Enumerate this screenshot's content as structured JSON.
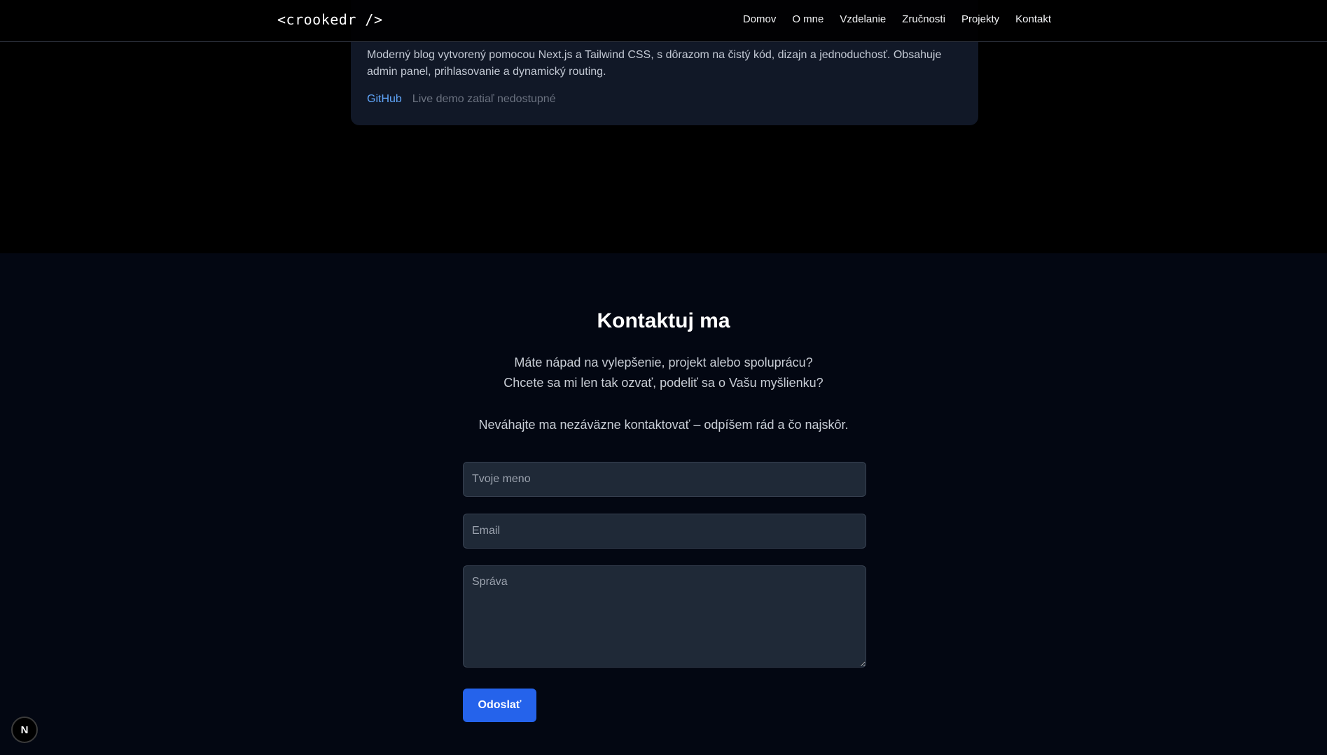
{
  "nav": {
    "logo": "<crookedr />",
    "links": [
      "Domov",
      "O mne",
      "Vzdelanie",
      "Zručnosti",
      "Projekty",
      "Kontakt"
    ]
  },
  "project": {
    "description": "Moderný blog vytvorený pomocou Next.js a Tailwind CSS, s dôrazom na čistý kód, dizajn a jednoduchosť. Obsahuje admin panel, prihlasovanie a dynamický routing.",
    "github_label": "GitHub",
    "demo_label": "Live demo zatiaľ nedostupné"
  },
  "contact": {
    "title": "Kontaktuj ma",
    "intro_line1": "Máte nápad na vylepšenie, projekt alebo spoluprácu?",
    "intro_line2": "Chcete sa mi len tak ozvať, podeliť sa o Vašu myšlienku?",
    "note": "Neváhajte ma nezáväzne kontaktovať – odpíšem rád a čo najskôr.",
    "name_placeholder": "Tvoje meno",
    "email_placeholder": "Email",
    "message_placeholder": "Správa",
    "submit_label": "Odoslať"
  },
  "dev_badge": {
    "icon": "nextjs-logo-icon",
    "letter": "N"
  },
  "colors": {
    "accent": "#2563eb",
    "link": "#60a5fa",
    "section_bg": "#030712",
    "card_bg": "#111827",
    "field_bg": "#1f2937"
  }
}
